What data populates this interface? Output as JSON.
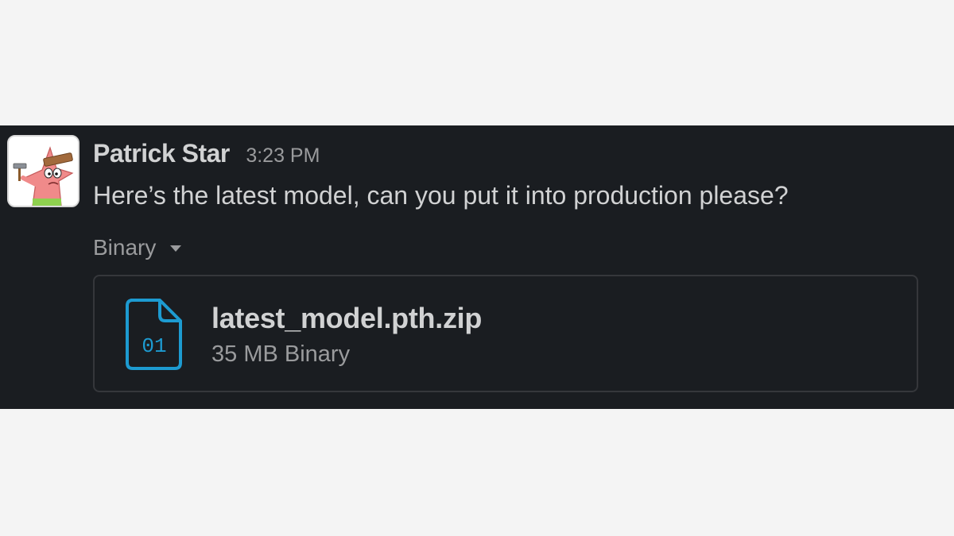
{
  "message": {
    "sender_name": "Patrick Star",
    "timestamp": "3:23 PM",
    "text": "Here’s the latest model, can you put it into production please?",
    "avatar_icon": "patrick-star-with-hammer-and-plank"
  },
  "attachment": {
    "section_label": "Binary",
    "file_icon": "binary-file-icon",
    "file_icon_glyph": "01",
    "file_name": "latest_model.pth.zip",
    "file_meta": "35 MB Binary"
  },
  "colors": {
    "panel_background": "#1a1d21",
    "page_background": "#f4f4f4",
    "primary_text": "#d1d2d3",
    "secondary_text": "#9a9b9d",
    "file_icon_accent": "#1d9bd1"
  }
}
